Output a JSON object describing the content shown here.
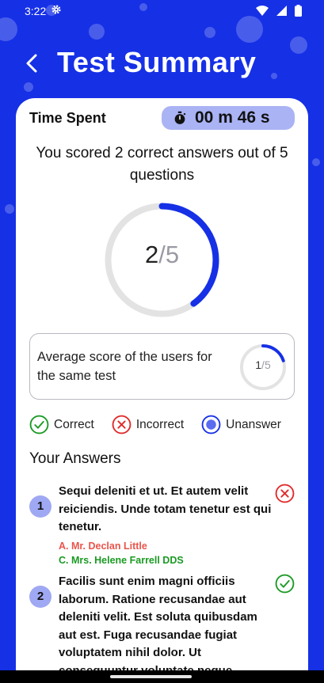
{
  "status_bar": {
    "time": "3:22",
    "icons": [
      "gear-icon",
      "wifi-icon",
      "signal-icon",
      "battery-icon"
    ]
  },
  "header": {
    "title": "Test Summary",
    "back_icon": "chevron-left-icon"
  },
  "time_spent": {
    "label": "Time Spent",
    "value": "00 m 46 s",
    "icon": "stopwatch-icon"
  },
  "score": {
    "headline": "You scored 2 correct answers out of 5 questions",
    "correct": "2",
    "separator": "/",
    "total": "5",
    "fraction": 0.4
  },
  "average": {
    "text": "Average score of the users for the same test",
    "correct": "1",
    "separator": "/",
    "total": "5",
    "fraction": 0.2
  },
  "legend": [
    {
      "label": "Correct",
      "icon": "check-circle-icon",
      "color": "#1a9a23"
    },
    {
      "label": "Incorrect",
      "icon": "x-circle-icon",
      "color": "#e02a2a"
    },
    {
      "label": "Unanswer",
      "icon": "radio-dot-icon",
      "color": "#1630e6"
    }
  ],
  "answers": {
    "title": "Your Answers",
    "items": [
      {
        "number": "1",
        "question": "Sequi deleniti et ut. Et autem velit reiciendis. Unde totam tenetur est qui tenetur.",
        "status": "incorrect",
        "selected_option": "A. Mr. Declan Little",
        "correct_option": "C. Mrs. Helene Farrell DDS"
      },
      {
        "number": "2",
        "question": "Facilis sunt enim magni officiis laborum. Ratione recusandae aut deleniti velit. Est soluta quibusdam aut est. Fuga recusandae fugiat voluptatem nihil dolor. Ut consequuntur voluptate neque",
        "status": "correct"
      }
    ]
  },
  "colors": {
    "background": "#1630e6",
    "accent": "#1630e6",
    "pill": "#aab3f4",
    "correct": "#1a9a23",
    "incorrect": "#e02a2a"
  }
}
